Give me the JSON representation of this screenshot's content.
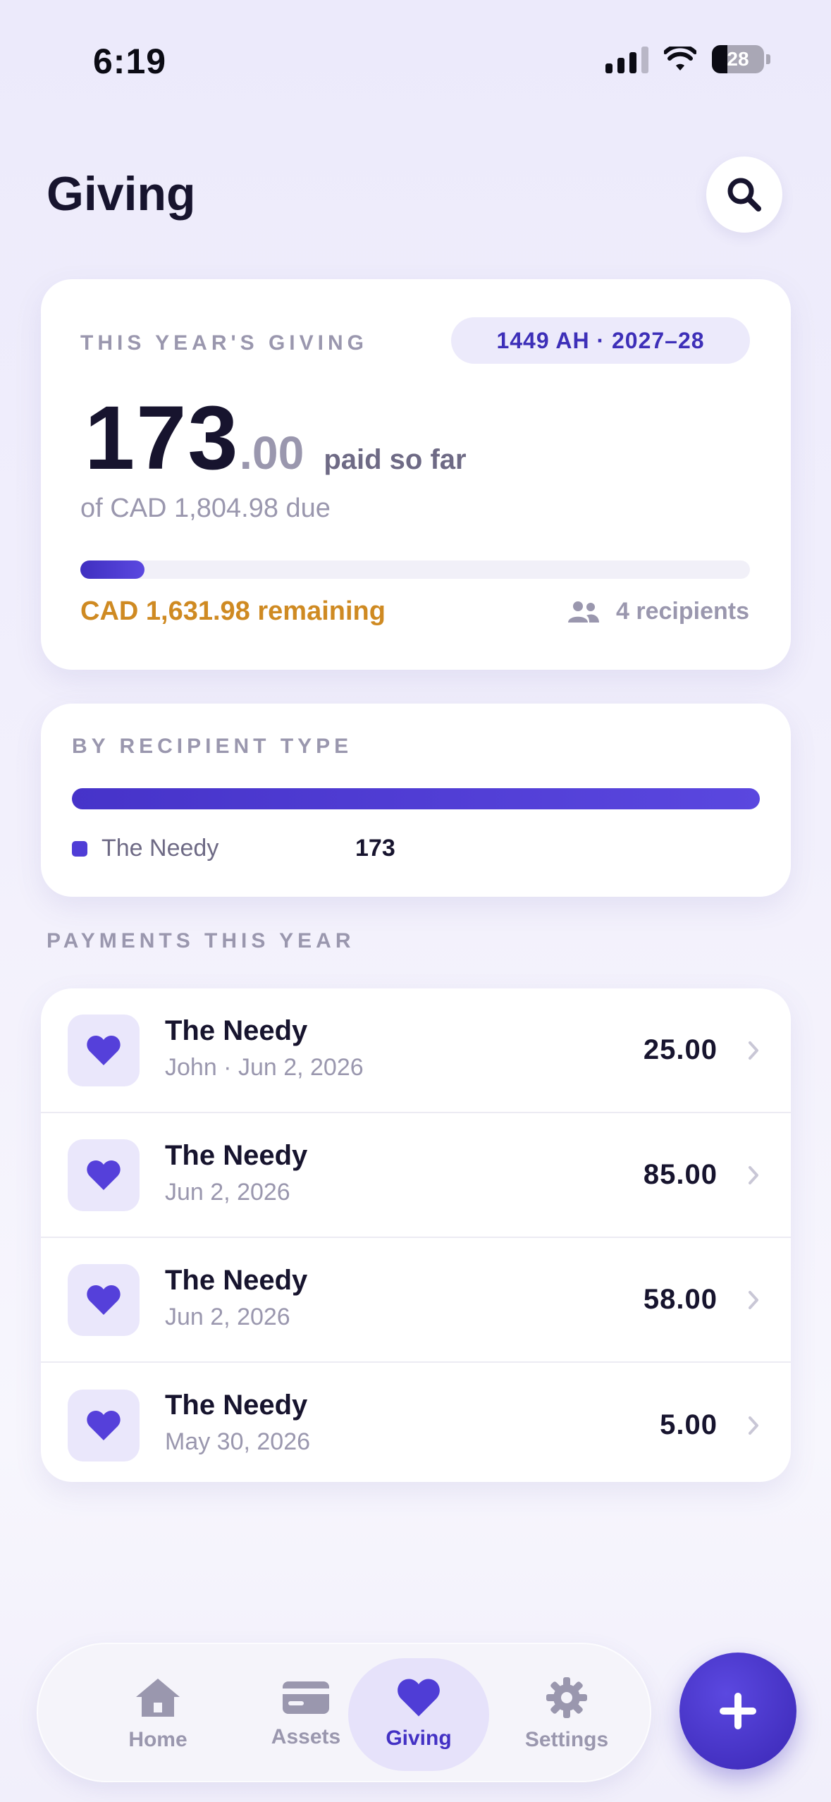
{
  "status_bar": {
    "time": "6:19",
    "battery": "28"
  },
  "header": {
    "title": "Giving"
  },
  "summary": {
    "eyebrow": "THIS YEAR'S GIVING",
    "year_pill": "1449 AH · 2027–28",
    "amount_int": "173",
    "amount_dec": ".00",
    "amount_suffix": "paid so far",
    "of_due": "of CAD 1,804.98 due",
    "progress_fraction": 0.0958,
    "remaining": "CAD 1,631.98 remaining",
    "recipients": "4 recipients"
  },
  "by_type": {
    "eyebrow": "BY RECIPIENT TYPE",
    "items": [
      {
        "label": "The Needy",
        "value": "173",
        "share": 1.0
      }
    ]
  },
  "payments": {
    "section_title": "PAYMENTS THIS YEAR",
    "rows": [
      {
        "title": "The Needy",
        "subtitle": "John · Jun 2, 2026",
        "amount": "25.00"
      },
      {
        "title": "The Needy",
        "subtitle": "Jun 2, 2026",
        "amount": "85.00"
      },
      {
        "title": "The Needy",
        "subtitle": "Jun 2, 2026",
        "amount": "58.00"
      },
      {
        "title": "The Needy",
        "subtitle": "May 30, 2026",
        "amount": "5.00"
      }
    ]
  },
  "tab_bar": {
    "tabs": [
      {
        "label": "Home",
        "icon": "home-icon"
      },
      {
        "label": "Assets",
        "icon": "card-icon"
      },
      {
        "label": "Giving",
        "icon": "heart-icon",
        "active": true
      },
      {
        "label": "Settings",
        "icon": "gear-icon"
      }
    ]
  },
  "colors": {
    "accent": "#4331C4",
    "warning": "#CF8A22",
    "muted": "#9A97AE"
  }
}
